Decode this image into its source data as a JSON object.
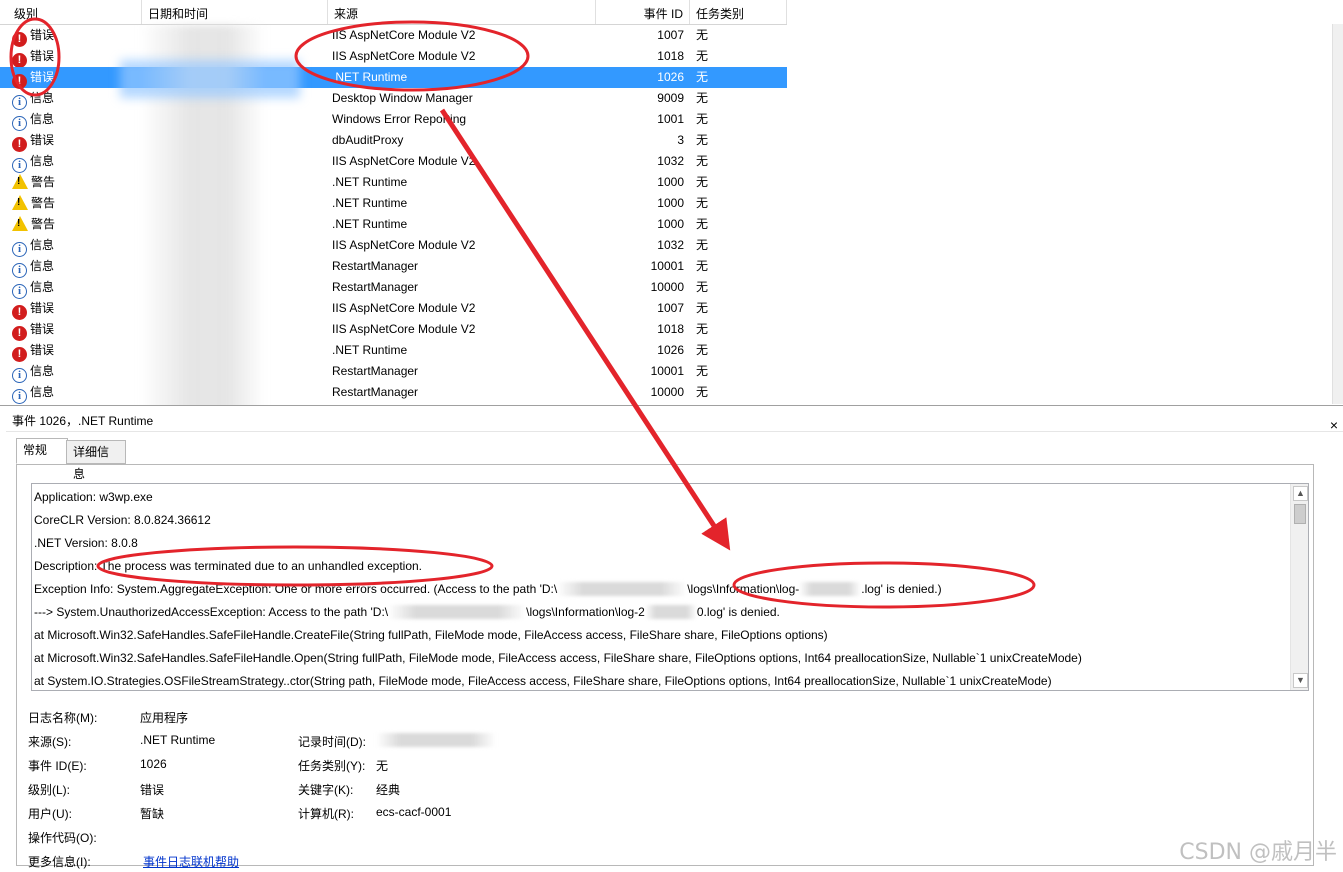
{
  "columns": {
    "level": "级别",
    "date": "日期和时间",
    "source": "来源",
    "event_id": "事件 ID",
    "task_category": "任务类别"
  },
  "events": [
    {
      "level": "错误",
      "type": "error",
      "source": "IIS AspNetCore Module V2",
      "id": "1007",
      "cat": "无"
    },
    {
      "level": "错误",
      "type": "error",
      "source": "IIS AspNetCore Module V2",
      "id": "1018",
      "cat": "无"
    },
    {
      "level": "错误",
      "type": "error",
      "source": ".NET Runtime",
      "id": "1026",
      "cat": "无",
      "selected": true
    },
    {
      "level": "信息",
      "type": "info",
      "source": "Desktop Window Manager",
      "id": "9009",
      "cat": "无"
    },
    {
      "level": "信息",
      "type": "info",
      "source": "Windows Error Reporting",
      "id": "1001",
      "cat": "无"
    },
    {
      "level": "错误",
      "type": "error",
      "source": "dbAuditProxy",
      "id": "3",
      "cat": "无"
    },
    {
      "level": "信息",
      "type": "info",
      "source": "IIS AspNetCore Module V2",
      "id": "1032",
      "cat": "无"
    },
    {
      "level": "警告",
      "type": "warn",
      "source": ".NET Runtime",
      "id": "1000",
      "cat": "无"
    },
    {
      "level": "警告",
      "type": "warn",
      "source": ".NET Runtime",
      "id": "1000",
      "cat": "无"
    },
    {
      "level": "警告",
      "type": "warn",
      "source": ".NET Runtime",
      "id": "1000",
      "cat": "无"
    },
    {
      "level": "信息",
      "type": "info",
      "source": "IIS AspNetCore Module V2",
      "id": "1032",
      "cat": "无"
    },
    {
      "level": "信息",
      "type": "info",
      "source": "RestartManager",
      "id": "10001",
      "cat": "无"
    },
    {
      "level": "信息",
      "type": "info",
      "source": "RestartManager",
      "id": "10000",
      "cat": "无"
    },
    {
      "level": "错误",
      "type": "error",
      "source": "IIS AspNetCore Module V2",
      "id": "1007",
      "cat": "无"
    },
    {
      "level": "错误",
      "type": "error",
      "source": "IIS AspNetCore Module V2",
      "id": "1018",
      "cat": "无"
    },
    {
      "level": "错误",
      "type": "error",
      "source": ".NET Runtime",
      "id": "1026",
      "cat": "无"
    },
    {
      "level": "信息",
      "type": "info",
      "source": "RestartManager",
      "id": "10001",
      "cat": "无"
    },
    {
      "level": "信息",
      "type": "info",
      "source": "RestartManager",
      "id": "10000",
      "cat": "无"
    }
  ],
  "detail": {
    "title": "事件 1026，.NET Runtime",
    "close_glyph": "×",
    "tabs": [
      "常规",
      "详细信息"
    ],
    "lines": {
      "l1": "Application: w3wp.exe",
      "l2": "CoreCLR Version: 8.0.824.36612",
      "l3": ".NET Version: 8.0.8",
      "l4": "Description: The process was terminated due to an unhandled exception.",
      "l5a": "Exception Info: System.AggregateException: One or more errors occurred. (Access to the path 'D:\\",
      "l5b": "\\logs\\Information\\log-",
      "l5c": ".log' is denied.)",
      "l6a": " ---> System.UnauthorizedAccessException: Access to the path 'D:\\",
      "l6b": "\\logs\\Information\\log-2",
      "l6c": "0.log' is denied.",
      "l7": "   at Microsoft.Win32.SafeHandles.SafeFileHandle.CreateFile(String fullPath, FileMode mode, FileAccess access, FileShare share, FileOptions options)",
      "l8": "   at Microsoft.Win32.SafeHandles.SafeFileHandle.Open(String fullPath, FileMode mode, FileAccess access, FileShare share, FileOptions options, Int64 preallocationSize, Nullable`1 unixCreateMode)",
      "l9": "   at System.IO.Strategies.OSFileStreamStrategy..ctor(String path, FileMode mode, FileAccess access, FileShare share, FileOptions options, Int64 preallocationSize, Nullable`1 unixCreateMode)"
    },
    "props": {
      "log_name_label": "日志名称(M):",
      "log_name": "应用程序",
      "source_label": "来源(S):",
      "source": ".NET Runtime",
      "logged_label": "记录时间(D):",
      "event_id_label": "事件 ID(E):",
      "event_id": "1026",
      "task_label": "任务类别(Y):",
      "task": "无",
      "level_label": "级别(L):",
      "level": "错误",
      "keywords_label": "关键字(K):",
      "keywords": "经典",
      "user_label": "用户(U):",
      "user": "暂缺",
      "computer_label": "计算机(R):",
      "computer": "ecs-cacf-0001",
      "opcode_label": "操作代码(O):",
      "more_info_label": "更多信息(I):",
      "more_info_link": "事件日志联机帮助"
    }
  },
  "watermark": "CSDN @戚月半",
  "colors": {
    "selection": "#3399ff",
    "error": "#d21d1d",
    "info": "#2a64b8",
    "warning": "#f2c200",
    "annotation": "#e3242b"
  }
}
